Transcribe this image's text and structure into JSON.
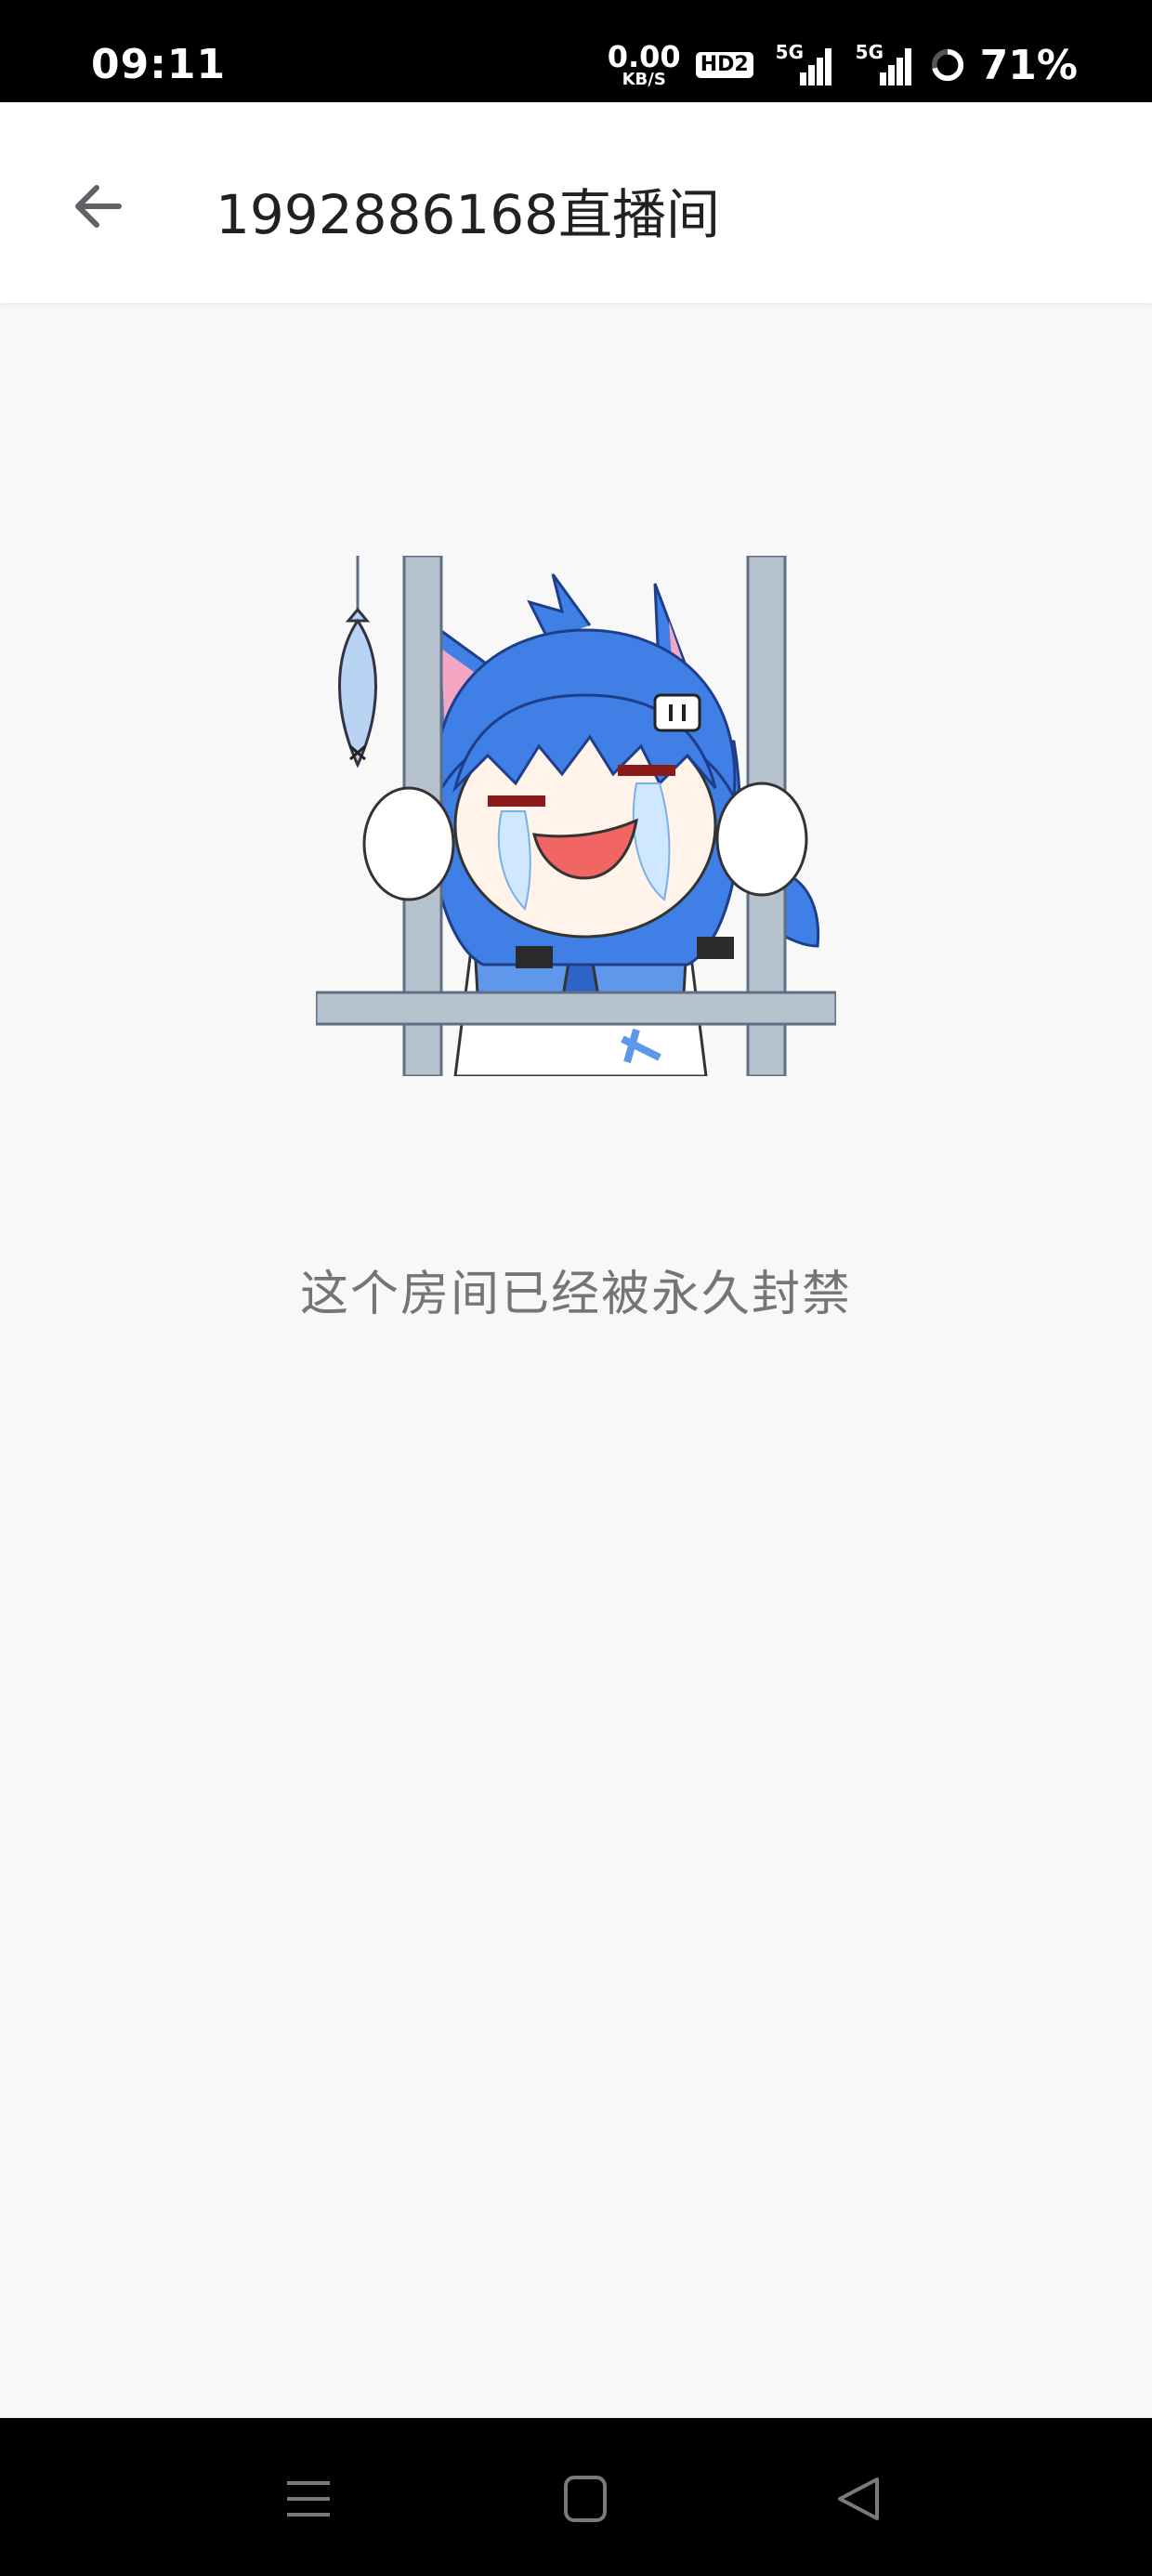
{
  "status_bar": {
    "time": "09:11",
    "net_speed_value": "0.00",
    "net_speed_unit": "KB/S",
    "hd_badge": "HD2",
    "signal_1_label": "5G",
    "signal_2_label": "5G",
    "battery_percent": "71%"
  },
  "header": {
    "title": "1992886168直播间",
    "back_icon": "arrow-left-icon"
  },
  "main": {
    "illustration": "crying-anime-cat-girl-behind-bars",
    "message": "这个房间已经被永久封禁"
  },
  "nav_bar": {
    "buttons": [
      "menu-icon",
      "home-square-icon",
      "back-triangle-icon"
    ]
  },
  "colors": {
    "status_bar_bg": "#000000",
    "app_bar_bg": "#ffffff",
    "page_bg": "#f8f8f8",
    "title_text": "#212121",
    "message_text": "#757575",
    "character_hair": "#3f7fe6"
  }
}
